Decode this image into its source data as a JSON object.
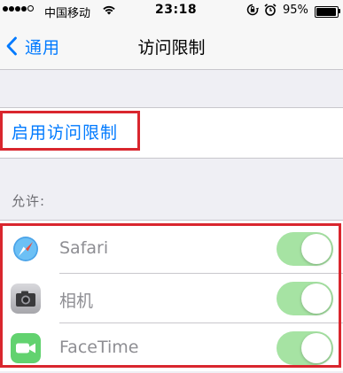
{
  "status_bar": {
    "carrier": "中国移动",
    "time": "23:18",
    "battery_percent": "95%",
    "battery_level": 0.95,
    "signal_bars": 4,
    "icons": [
      "wifi-icon",
      "rotation-lock-icon",
      "alarm-icon",
      "battery-icon"
    ]
  },
  "nav": {
    "back_label": "通用",
    "title": "访问限制"
  },
  "enable": {
    "label": "启用访问限制"
  },
  "allow": {
    "header": "允许:",
    "items": [
      {
        "label": "Safari",
        "icon": "safari-icon",
        "enabled": true
      },
      {
        "label": "相机",
        "icon": "camera-icon",
        "enabled": true
      },
      {
        "label": "FaceTime",
        "icon": "facetime-icon",
        "enabled": true
      }
    ]
  },
  "colors": {
    "accent": "#007aff",
    "toggle_on_disabled": "#a6e3a3",
    "highlight": "#d9262e",
    "background": "#efeff4"
  }
}
